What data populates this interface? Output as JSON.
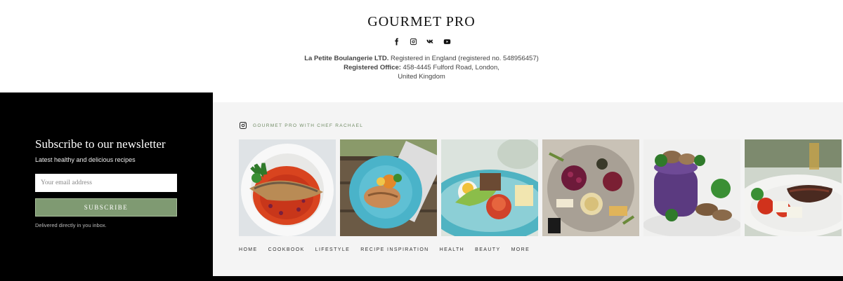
{
  "brand": {
    "name": "GOURMET PRO"
  },
  "socials": [
    "facebook-icon",
    "instagram-icon",
    "vk-icon",
    "youtube-icon"
  ],
  "company": {
    "name": "La Petite Boulangerie LTD.",
    "registration": " Registered in England (registered no. 548956457)",
    "office_label": "Registered Office:",
    "office_address": " 458-4445 Fulford Road, London,",
    "country": "United Kingdom"
  },
  "newsletter": {
    "title": "Subscribe to our newsletter",
    "subtitle": "Latest healthy and delicious recipes",
    "email_placeholder": "Your email address",
    "button_label": "SUBSCRIBE",
    "note": "Delivered directly in you inbox."
  },
  "instagram": {
    "label": "GOURMET PRO WITH CHEF RACHAEL",
    "photos": [
      "fish-tomato-dish",
      "salmon-blue-plate",
      "egg-salad-plate",
      "berries-cheese-platter",
      "mushroom-purple-stack",
      "steak-salad-plate"
    ]
  },
  "nav": [
    "HOME",
    "COOKBOOK",
    "LIFESTYLE",
    "RECIPE INSPIRATION",
    "HEALTH",
    "BEAUTY",
    "MORE"
  ],
  "colors": {
    "accent": "#7f9a72",
    "panel": "#000000",
    "gallery_bg": "#f4f4f4"
  }
}
